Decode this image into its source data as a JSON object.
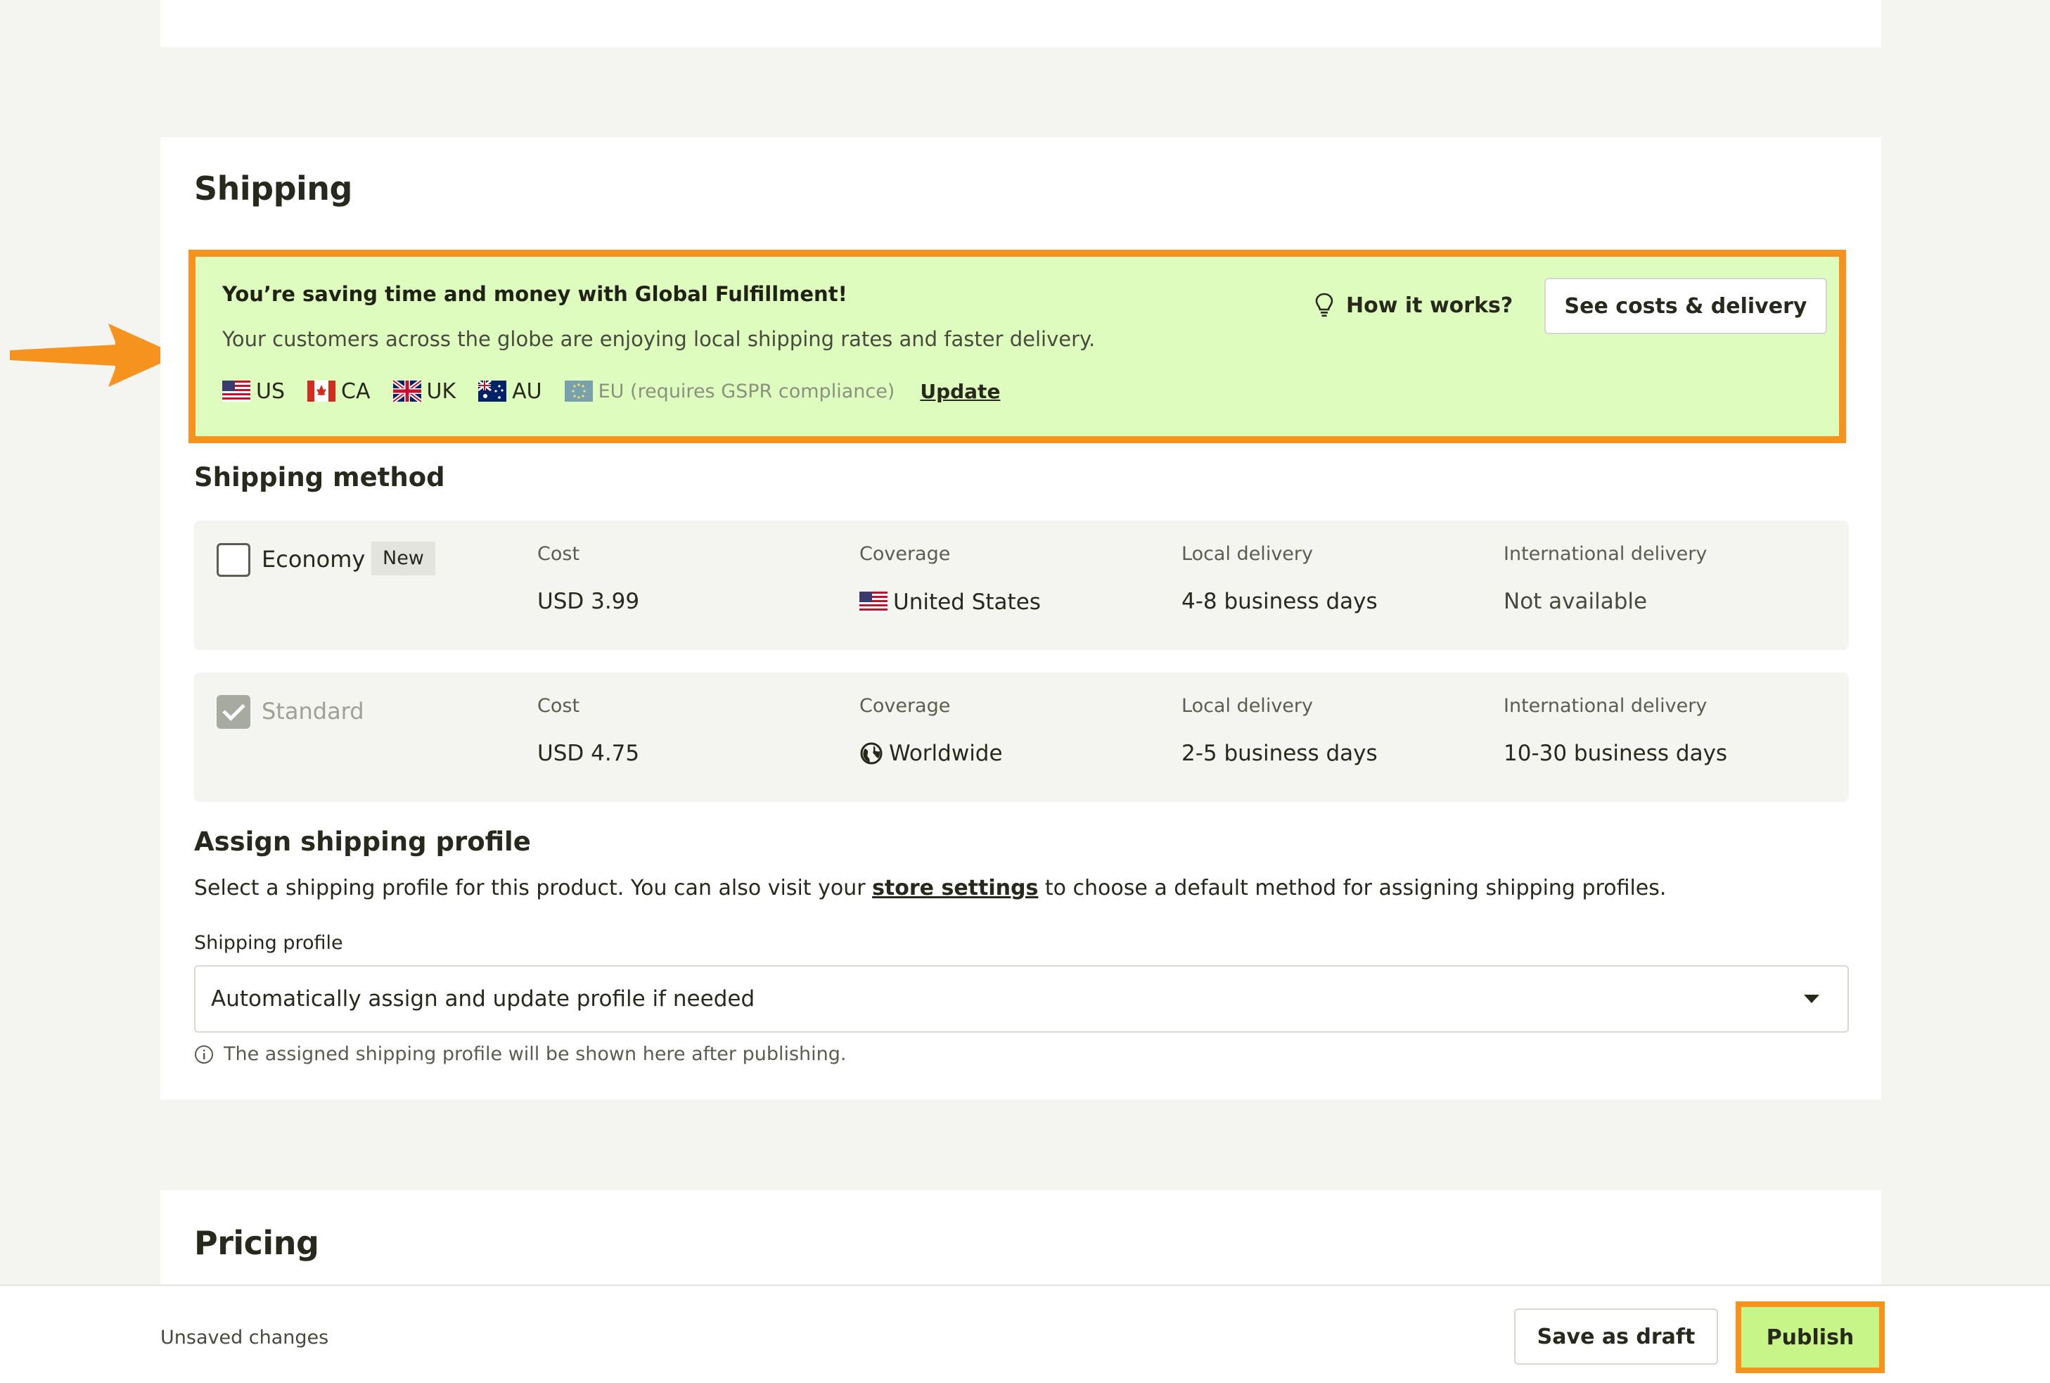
{
  "shipping": {
    "title": "Shipping",
    "banner": {
      "title": "You’re saving time and money with Global Fulfillment!",
      "subtitle": "Your customers across the globe are enjoying local shipping rates and faster delivery.",
      "countries": [
        {
          "code": "US",
          "flag": "us-flag-icon"
        },
        {
          "code": "CA",
          "flag": "ca-flag-icon"
        },
        {
          "code": "UK",
          "flag": "uk-flag-icon"
        },
        {
          "code": "AU",
          "flag": "au-flag-icon"
        }
      ],
      "eu_label": "EU (requires GSPR compliance)",
      "update_label": "Update",
      "how_it_works_label": "How it works?",
      "costs_button_label": "See costs & delivery"
    },
    "method_heading": "Shipping method",
    "methods": [
      {
        "name": "Economy",
        "badge": "New",
        "checked": false,
        "cost_label": "Cost",
        "cost": "USD 3.99",
        "coverage_label": "Coverage",
        "coverage": "United States",
        "coverage_icon": "us-flag-icon",
        "local_label": "Local delivery",
        "local": "4-8 business days",
        "intl_label": "International delivery",
        "intl": "Not available"
      },
      {
        "name": "Standard",
        "checked": true,
        "cost_label": "Cost",
        "cost": "USD 4.75",
        "coverage_label": "Coverage",
        "coverage": "Worldwide",
        "coverage_icon": "globe-icon",
        "local_label": "Local delivery",
        "local": "2-5 business days",
        "intl_label": "International delivery",
        "intl": "10-30 business days"
      }
    ],
    "profile": {
      "heading": "Assign shipping profile",
      "desc_before": "Select a shipping profile for this product. You can also visit your ",
      "desc_link": "store settings",
      "desc_after": " to choose a default method for assigning shipping profiles.",
      "field_label": "Shipping profile",
      "selected": "Automatically assign and update profile if needed",
      "hint": "The assigned shipping profile will be shown here after publishing."
    }
  },
  "pricing": {
    "title": "Pricing"
  },
  "footer": {
    "status": "Unsaved changes",
    "draft_label": "Save as draft",
    "publish_label": "Publish"
  },
  "colors": {
    "highlight": "#f6931f",
    "banner_bg": "#dffcbf",
    "publish_bg": "#c7f587",
    "page_bg": "#f4f4f0"
  }
}
